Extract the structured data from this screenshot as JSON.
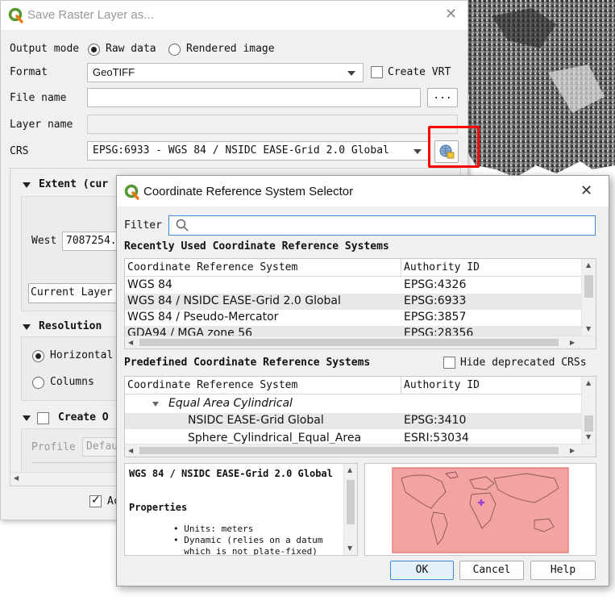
{
  "main_dialog": {
    "title": "Save Raster Layer as...",
    "output_mode_label": "Output mode",
    "output_mode_options": [
      "Raw data",
      "Rendered image"
    ],
    "format_label": "Format",
    "format_value": "GeoTIFF",
    "create_vrt_label": "Create VRT",
    "file_name_label": "File name",
    "browse_button": "...",
    "layer_name_label": "Layer name",
    "crs_label": "CRS",
    "crs_value": "EPSG:6933 - WGS 84 / NSIDC EASE-Grid 2.0 Global",
    "extent_section": "Extent (cur",
    "west_label": "West",
    "west_value": "7087254.",
    "current_layer_button": "Current Layer",
    "resolution_section": "Resolution",
    "horizontal_label": "Horizontal",
    "columns_label": "Columns",
    "create_options_section": "Create O",
    "profile_label": "Profile",
    "profile_value": "Defau",
    "add_label": "Ac"
  },
  "crs_dialog": {
    "title": "Coordinate Reference System Selector",
    "filter_label": "Filter",
    "filter_value": "",
    "recent_section": "Recently Used Coordinate Reference Systems",
    "recent_headers": [
      "Coordinate Reference System",
      "Authority ID"
    ],
    "recent_rows": [
      {
        "name": "WGS 84",
        "auth": "EPSG:4326"
      },
      {
        "name": "WGS 84 / NSIDC EASE-Grid 2.0 Global",
        "auth": "EPSG:6933"
      },
      {
        "name": "WGS 84 / Pseudo-Mercator",
        "auth": "EPSG:3857"
      },
      {
        "name": "GDA94 / MGA zone 56",
        "auth": "EPSG:28356"
      }
    ],
    "predefined_section": "Predefined Coordinate Reference Systems",
    "hide_deprecated_label": "Hide deprecated CRSs",
    "predefined_headers": [
      "Coordinate Reference System",
      "Authority ID"
    ],
    "predefined_group": "Equal Area Cylindrical",
    "predefined_rows": [
      {
        "name": "NSIDC EASE-Grid Global",
        "auth": "EPSG:3410"
      },
      {
        "name": "Sphere_Cylindrical_Equal_Area",
        "auth": "ESRI:53034"
      }
    ],
    "info_title": "WGS 84 / NSIDC EASE-Grid 2.0 Global",
    "info_properties": "Properties",
    "info_bullets": [
      "Units: meters",
      "Dynamic (relies on a datum",
      "which is not plate-fixed)"
    ],
    "ok_button": "OK",
    "cancel_button": "Cancel",
    "help_button": "Help"
  },
  "colors": {
    "highlight": "#ff0000",
    "map_extent": "#f4a3a3",
    "selected_row": "#e8e8e8"
  }
}
